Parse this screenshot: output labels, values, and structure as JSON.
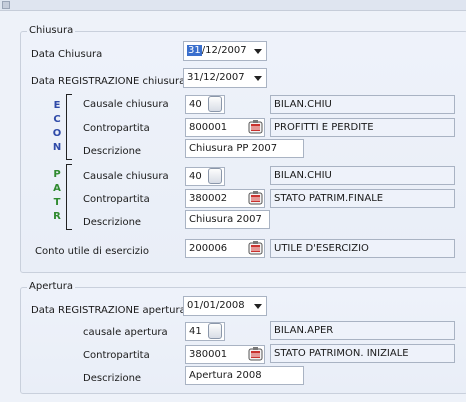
{
  "chiusura": {
    "title": "Chiusura",
    "data_chiusura": {
      "label": "Data Chiusura",
      "value_sel": "31",
      "value_rest": "/12/2007"
    },
    "data_registrazione": {
      "label": "Data REGISTRAZIONE chiusura",
      "value": "31/12/2007"
    },
    "econ": {
      "letters": "ECON",
      "causale": {
        "label": "Causale chiusura",
        "code": "40",
        "desc": "BILAN.CHIU"
      },
      "contropartita": {
        "label": "Contropartita",
        "code": "800001",
        "desc": "PROFITTI E PERDITE"
      },
      "descrizione": {
        "label": "Descrizione",
        "value": "Chiusura PP 2007"
      }
    },
    "patr": {
      "letters": "PATR",
      "causale": {
        "label": "Causale chiusura",
        "code": "40",
        "desc": "BILAN.CHIU"
      },
      "contropartita": {
        "label": "Contropartita",
        "code": "380002",
        "desc": "STATO PATRIM.FINALE"
      },
      "descrizione": {
        "label": "Descrizione",
        "value": "Chiusura 2007"
      }
    },
    "conto_utile": {
      "label": "Conto utile di esercizio",
      "code": "200006",
      "desc": "UTILE D'ESERCIZIO"
    }
  },
  "apertura": {
    "title": "Apertura",
    "data_registrazione": {
      "label": "Data REGISTRAZIONE apertura",
      "value": "01/01/2008"
    },
    "causale": {
      "label": "causale apertura",
      "code": "41",
      "desc": "BILAN.APER"
    },
    "contropartita": {
      "label": "Contropartita",
      "code": "380001",
      "desc": "STATO PATRIMON. INIZIALE"
    },
    "descrizione": {
      "label": "Descrizione",
      "value": "Apertura 2008"
    }
  },
  "icons": {
    "lookup_button": "square-button-icon",
    "search_button": "binder-lookup-icon"
  },
  "colors": {
    "econ_letters": "#2f4aa8",
    "patr_letters": "#2f8a2f",
    "highlight": "#3a6fcd"
  }
}
